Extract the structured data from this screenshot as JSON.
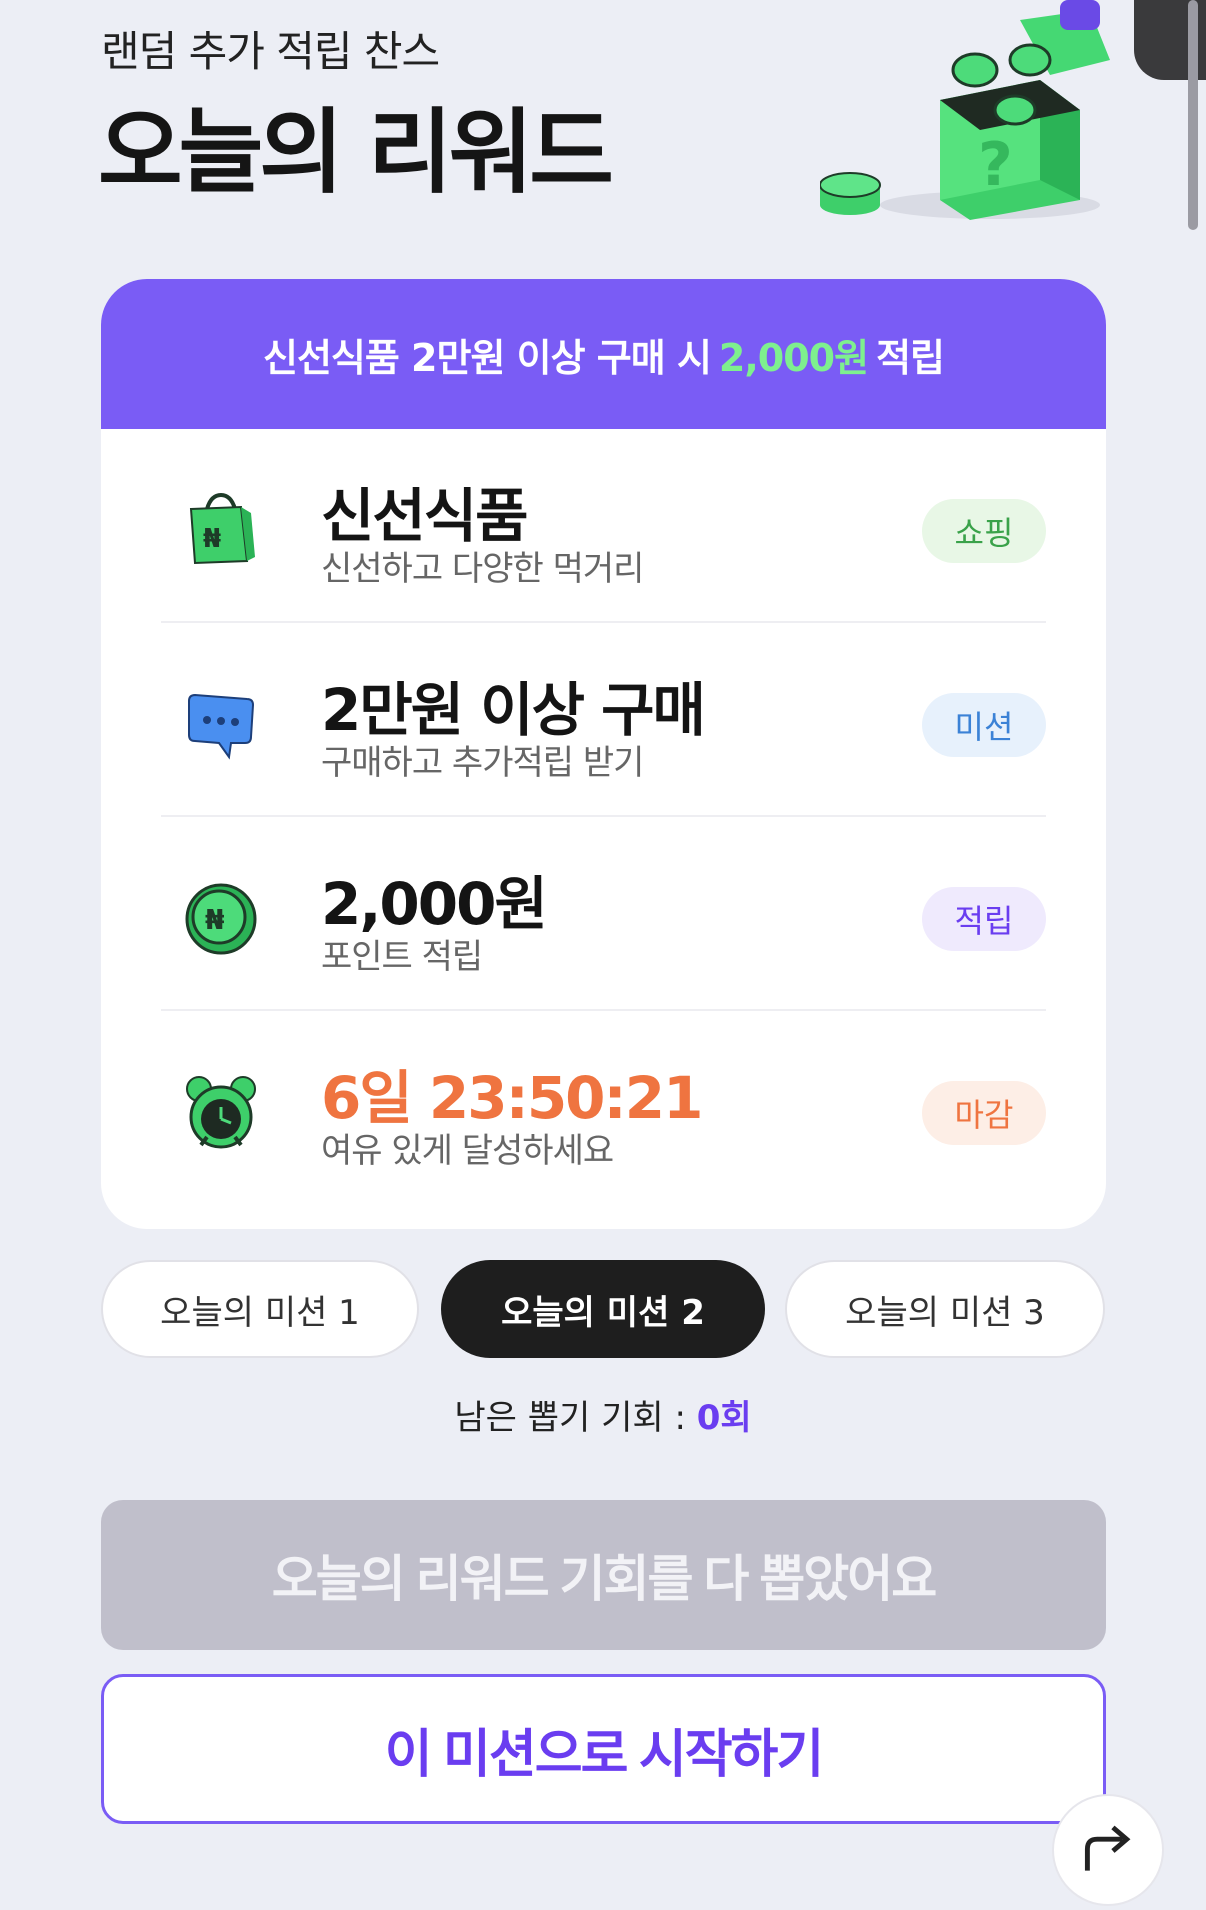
{
  "header": {
    "subtitle": "랜덤 추가 적립 찬스",
    "title": "오늘의 리워드"
  },
  "card": {
    "banner": {
      "prefix": "신선식품 2만원 이상 구매 시",
      "amount": "2,000원",
      "suffix": "적립"
    },
    "rows": [
      {
        "icon": "shopping-bag-icon",
        "name": "신선식품",
        "desc": "신선하고 다양한 먹거리",
        "tag": "쇼핑",
        "tag_bg": "#e8f7e6",
        "tag_color": "#3aa24a"
      },
      {
        "icon": "chat-bubble-icon",
        "name": "2만원 이상 구매",
        "desc": "구매하고 추가적립 받기",
        "tag": "미션",
        "tag_bg": "#e7f1fc",
        "tag_color": "#3b82d6"
      },
      {
        "icon": "point-coin-icon",
        "name": "2,000원",
        "desc": "포인트 적립",
        "tag": "적립",
        "tag_bg": "#efeafd",
        "tag_color": "#6a3df0"
      },
      {
        "icon": "alarm-clock-icon",
        "name": "6일 23:50:21",
        "desc": "여유 있게 달성하세요",
        "tag": "마감",
        "tag_bg": "#fdeee6",
        "tag_color": "#ef7440"
      }
    ]
  },
  "tabs": [
    {
      "label": "오늘의 미션 1",
      "active": false
    },
    {
      "label": "오늘의 미션 2",
      "active": true
    },
    {
      "label": "오늘의 미션 3",
      "active": false
    }
  ],
  "remaining": {
    "label": "남은 뽑기 기회 :",
    "count": "0회"
  },
  "buttons": {
    "disabled_label": "오늘의 리워드 기회를 다 뽑았어요",
    "start_label": "이 미션으로 시작하기"
  },
  "colors": {
    "accent": "#7a5cf5",
    "green_highlight": "#7ef08e",
    "timer_orange": "#ef7440"
  }
}
